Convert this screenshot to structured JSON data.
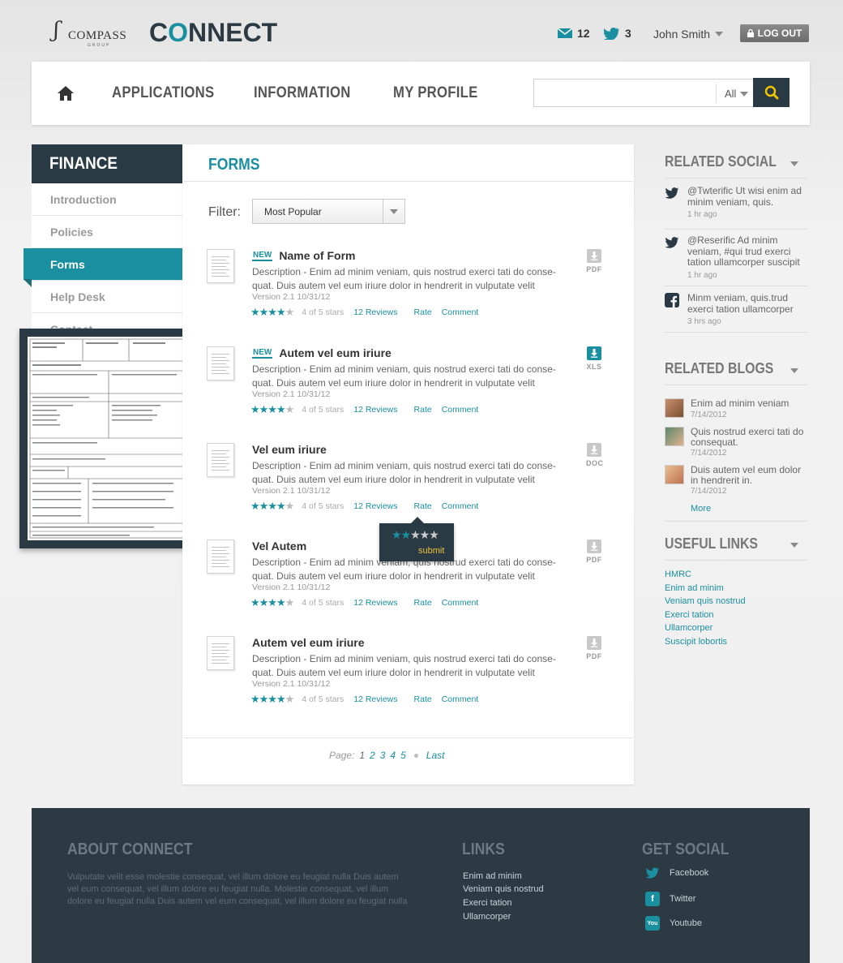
{
  "header": {
    "compass_logo": "COMPASS",
    "compass_sub": "GROUP",
    "app_logo_pre": "C",
    "app_logo_o": "O",
    "app_logo_post": "NNECT",
    "messages_count": "12",
    "twitter_count": "3",
    "user_name": "John Smith",
    "logout_label": "LOG OUT"
  },
  "nav": {
    "items": [
      "APPLICATIONS",
      "INFORMATION",
      "MY PROFILE"
    ],
    "search_placeholder": "",
    "search_scope": "All"
  },
  "sidebar": {
    "title": "FINANCE",
    "items": [
      "Introduction",
      "Policies",
      "Forms",
      "Help Desk",
      "Contact"
    ],
    "active": "Forms"
  },
  "main": {
    "title": "FORMS",
    "filter_label": "Filter:",
    "filter_value": "Most Popular",
    "forms": [
      {
        "title": "Name of Form",
        "new": true,
        "new_label": "NEW",
        "desc": "Description - Enim ad minim veniam, quis nostrud exerci tati do conse-quat. Duis autem vel eum iriure dolor in hendrerit in vulputate velit",
        "version": "Version 2.1 10/31/12",
        "rating_text": "4 of 5 stars",
        "reviews": "12 Reviews",
        "rate": "Rate",
        "comment": "Comment",
        "type": "PDF"
      },
      {
        "title": "Autem vel eum iriure",
        "new": true,
        "new_label": "NEW",
        "desc": "Description - Enim ad minim veniam, quis nostrud exerci tati do conse-quat. Duis autem vel eum iriure dolor in hendrerit in vulputate velit",
        "version": "Version 2.1 10/31/12",
        "rating_text": "4 of 5 stars",
        "reviews": "12 Reviews",
        "rate": "Rate",
        "comment": "Comment",
        "type": "XLS"
      },
      {
        "title": "Vel eum iriure",
        "new": false,
        "desc": "Description - Enim ad minim veniam, quis nostrud exerci tati do conse-quat. Duis autem vel eum iriure dolor in hendrerit in vulputate velit",
        "version": "Version 2.1 10/31/12",
        "rating_text": "4 of 5 stars",
        "reviews": "12 Reviews",
        "rate": "Rate",
        "comment": "Comment",
        "type": "DOC"
      },
      {
        "title": "Vel Autem",
        "new": false,
        "desc": "Description - Enim ad minim veniam, quis nostrud exerci tati do conse-quat. Duis autem vel eum iriure dolor in hendrerit in vulputate velit",
        "version": "Version 2.1 10/31/12",
        "rating_text": "4 of 5 stars",
        "reviews": "12 Reviews",
        "rate": "Rate",
        "comment": "Comment",
        "type": "PDF"
      },
      {
        "title": "Autem vel eum iriure",
        "new": false,
        "desc": "Description - Enim ad minim veniam, quis nostrud exerci tati do conse-quat. Duis autem vel eum iriure dolor in hendrerit in vulputate velit",
        "version": "Version 2.1 10/31/12",
        "rating_text": "4 of 5 stars",
        "reviews": "12 Reviews",
        "rate": "Rate",
        "comment": "Comment",
        "type": "PDF"
      }
    ],
    "rate_popup": {
      "submit": "submit",
      "rating": 2,
      "max": 5
    },
    "pager": {
      "label": "Page:",
      "pages": [
        "1",
        "2",
        "3",
        "4",
        "5"
      ],
      "last": "Last"
    }
  },
  "right": {
    "social_title": "RELATED SOCIAL",
    "social": [
      {
        "icon": "twitter-icon",
        "text": "@Twterific Ut wisi enim ad minim veniam, quis.",
        "time": "1 hr ago"
      },
      {
        "icon": "twitter-icon",
        "text": "@Reserific Ad minim veniam, #qui trud exerci tation ullamcorper suscipit",
        "time": "1 hr ago"
      },
      {
        "icon": "facebook-icon",
        "text": "Minm veniam, quis.trud exerci tation ullamcorper",
        "time": "3 hrs ago"
      }
    ],
    "blogs_title": "RELATED BLOGS",
    "blogs": [
      {
        "text": "Enim ad minim veniam",
        "date": "7/14/2012"
      },
      {
        "text": "Quis nostrud exerci tati do consequat.",
        "date": "7/14/2012"
      },
      {
        "text": "Duis autem vel eum dolor in hendrerit in.",
        "date": "7/14/2012"
      }
    ],
    "more": "More",
    "links_title": "USEFUL LINKS",
    "links": [
      "HMRC",
      "Enim ad minim",
      "Veniam quis nostrud",
      "Exerci tation",
      "Ullamcorper",
      "Suscipit lobortis"
    ]
  },
  "footer": {
    "about_title": "ABOUT CONNECT",
    "about_text": "Vulputate velit esse molestie consequat, vel illum dolore eu feugiat nulla Duis autem vel eum consequat, vel illum dolore eu feugiat nulla.  Molestie consequat, vel illum dolore eu feugiat nulla Duis autem vel eum consequat, vel illum dolore eu feugiat nulla",
    "links_title": "LINKS",
    "links": [
      "Enim ad minim",
      "Veniam quis nostrud",
      "Exerci tation",
      "Ullamcorper"
    ],
    "social_title": "GET SOCIAL",
    "social": [
      "Facebook",
      "Twitter",
      "Youtube"
    ]
  },
  "colors": {
    "accent": "#1a8fa0",
    "dark": "#2a3a44"
  }
}
